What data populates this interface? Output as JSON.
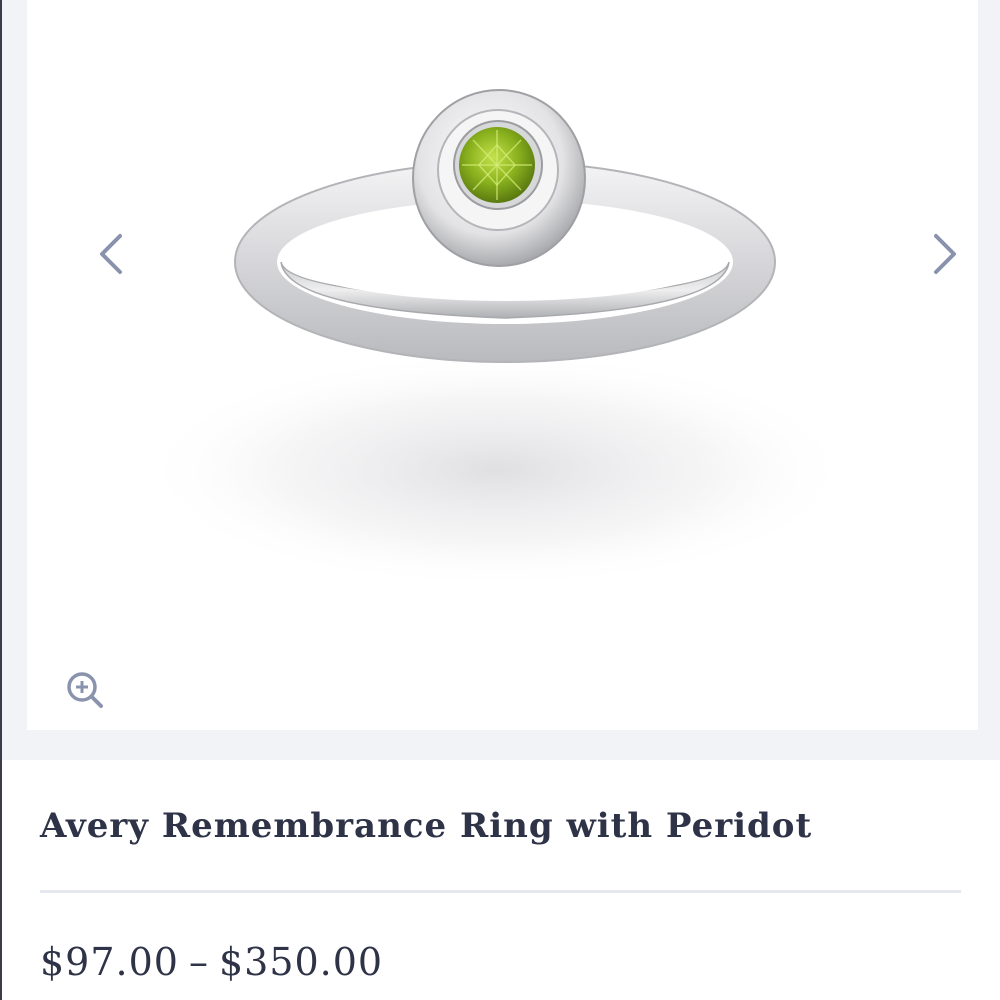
{
  "gallery": {
    "image_alt": "Avery Remembrance Ring with Peridot",
    "prev_icon": "chevron-left-icon",
    "next_icon": "chevron-right-icon",
    "zoom_icon": "zoom-in-icon"
  },
  "product": {
    "title": "Avery Remembrance Ring with Peridot",
    "price_low": "$97.00",
    "price_separator": "–",
    "price_high": "$350.00"
  },
  "colors": {
    "text": "#2f3347",
    "arrow": "#8a93ad",
    "frame_bg": "#f2f3f7",
    "divider": "#e6e8ef",
    "gem": "#8ab21e"
  }
}
